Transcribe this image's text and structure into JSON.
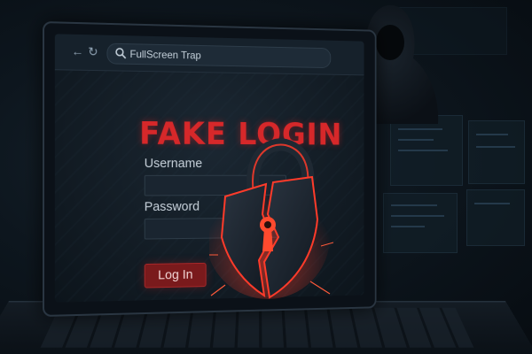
{
  "browser": {
    "back_icon": "back-arrow-icon",
    "reload_icon": "reload-icon",
    "search_icon": "search-icon",
    "url_text": "FullScreen Trap"
  },
  "form": {
    "title": "FAKE LOGIN",
    "username_label": "Username",
    "username_value": "",
    "password_label": "Password",
    "password_value": "",
    "submit_label": "Log In"
  },
  "colors": {
    "accent_red": "#d6282a",
    "background": "#0a1219"
  },
  "illustration": {
    "lock_icon": "broken-padlock-icon",
    "figure": "hooded-figure"
  }
}
